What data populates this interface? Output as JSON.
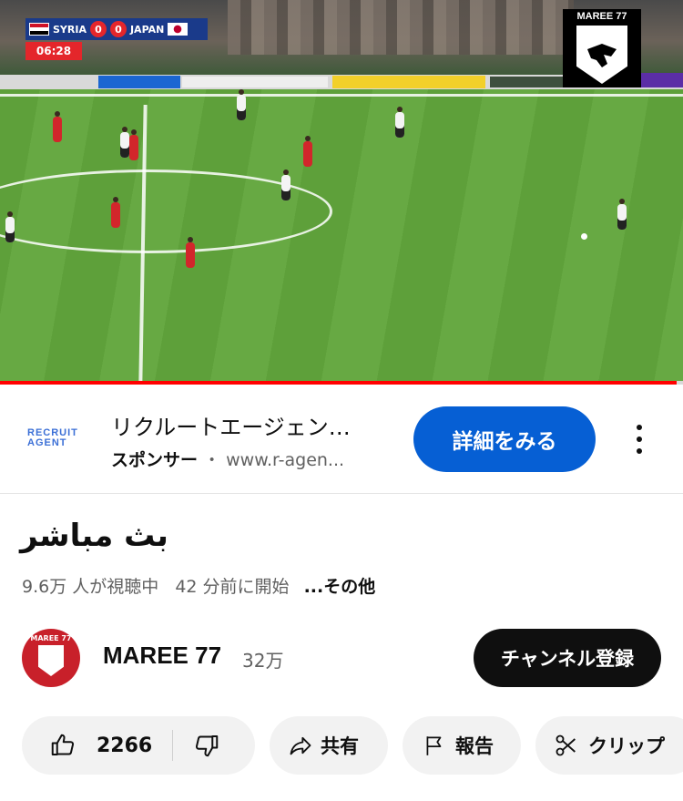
{
  "video": {
    "scorebug": {
      "team_home": "SYRIA",
      "score_home": "0",
      "score_away": "0",
      "team_away": "JAPAN",
      "clock": "06:28"
    },
    "channel_logo_text": "MAREE 77",
    "progress_fraction": 0.99
  },
  "ad": {
    "logo_line1": "RECRUIT",
    "logo_line2": "AGENT",
    "title": "リクルートエージェン…",
    "sponsor_label": "スポンサー",
    "separator": "・",
    "url": "www.r-agen...",
    "cta_label": "詳細をみる"
  },
  "video_info": {
    "title": "بث مباشر",
    "views": "9.6万 人が視聴中",
    "started": "42 分前に開始",
    "more_label": "...その他"
  },
  "channel": {
    "avatar_text": "MAREE 77",
    "name": "MAREE 77",
    "subscribers": "32万",
    "subscribe_label": "チャンネル登録"
  },
  "actions": {
    "like_count": "2266",
    "share_label": "共有",
    "report_label": "報告",
    "clip_label": "クリップ"
  },
  "colors": {
    "accent": "#065fd4",
    "progress": "#ff0000",
    "subscribe_bg": "#0f0f0f"
  }
}
